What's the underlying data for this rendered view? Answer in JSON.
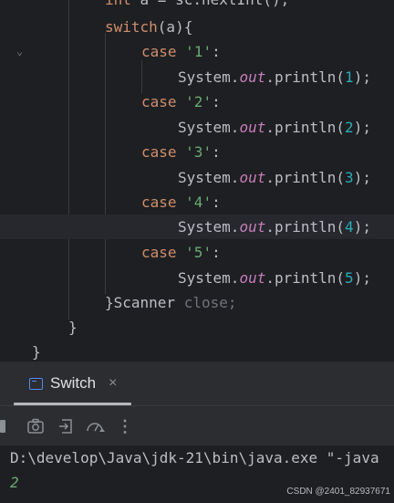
{
  "editor": {
    "line_top_partial": [
      "int",
      " a = ",
      "sc",
      ".nextInt();"
    ],
    "switch_kw": "switch",
    "switch_rest": "(a){",
    "cases": [
      {
        "kw": "case",
        "label": "'1'",
        "colon": ":",
        "sys": "System.",
        "out": "out",
        "println": ".println(",
        "arg": "1",
        "end": ");"
      },
      {
        "kw": "case",
        "label": "'2'",
        "colon": ":",
        "sys": "System.",
        "out": "out",
        "println": ".println(",
        "arg": "2",
        "end": ");"
      },
      {
        "kw": "case",
        "label": "'3'",
        "colon": ":",
        "sys": "System.",
        "out": "out",
        "println": ".println(",
        "arg": "3",
        "end": ");"
      },
      {
        "kw": "case",
        "label": "'4'",
        "colon": ":",
        "sys": "System.",
        "out": "out",
        "println": ".println(",
        "arg": "4",
        "end": ");"
      },
      {
        "kw": "case",
        "label": "'5'",
        "colon": ":",
        "sys": "System.",
        "out": "out",
        "println": ".println(",
        "arg": "5",
        "end": ");"
      }
    ],
    "close_brace_text": "}Scanner",
    "close_call": " close;",
    "brace_inner": "}",
    "brace_outer": "}"
  },
  "run_window": {
    "tab_label": "Switch",
    "close_glyph": "×",
    "more_glyph": "⋮"
  },
  "console": {
    "command": "D:\\develop\\Java\\jdk-21\\bin\\java.exe \"-java",
    "output": "2"
  },
  "watermark": "CSDN @2401_82937671",
  "colors": {
    "keyword": "#cf8e6d",
    "string": "#6aab73",
    "number": "#2aacb8",
    "field": "#c77dbb",
    "text": "#bcbec4",
    "output_green": "#6aab73"
  }
}
